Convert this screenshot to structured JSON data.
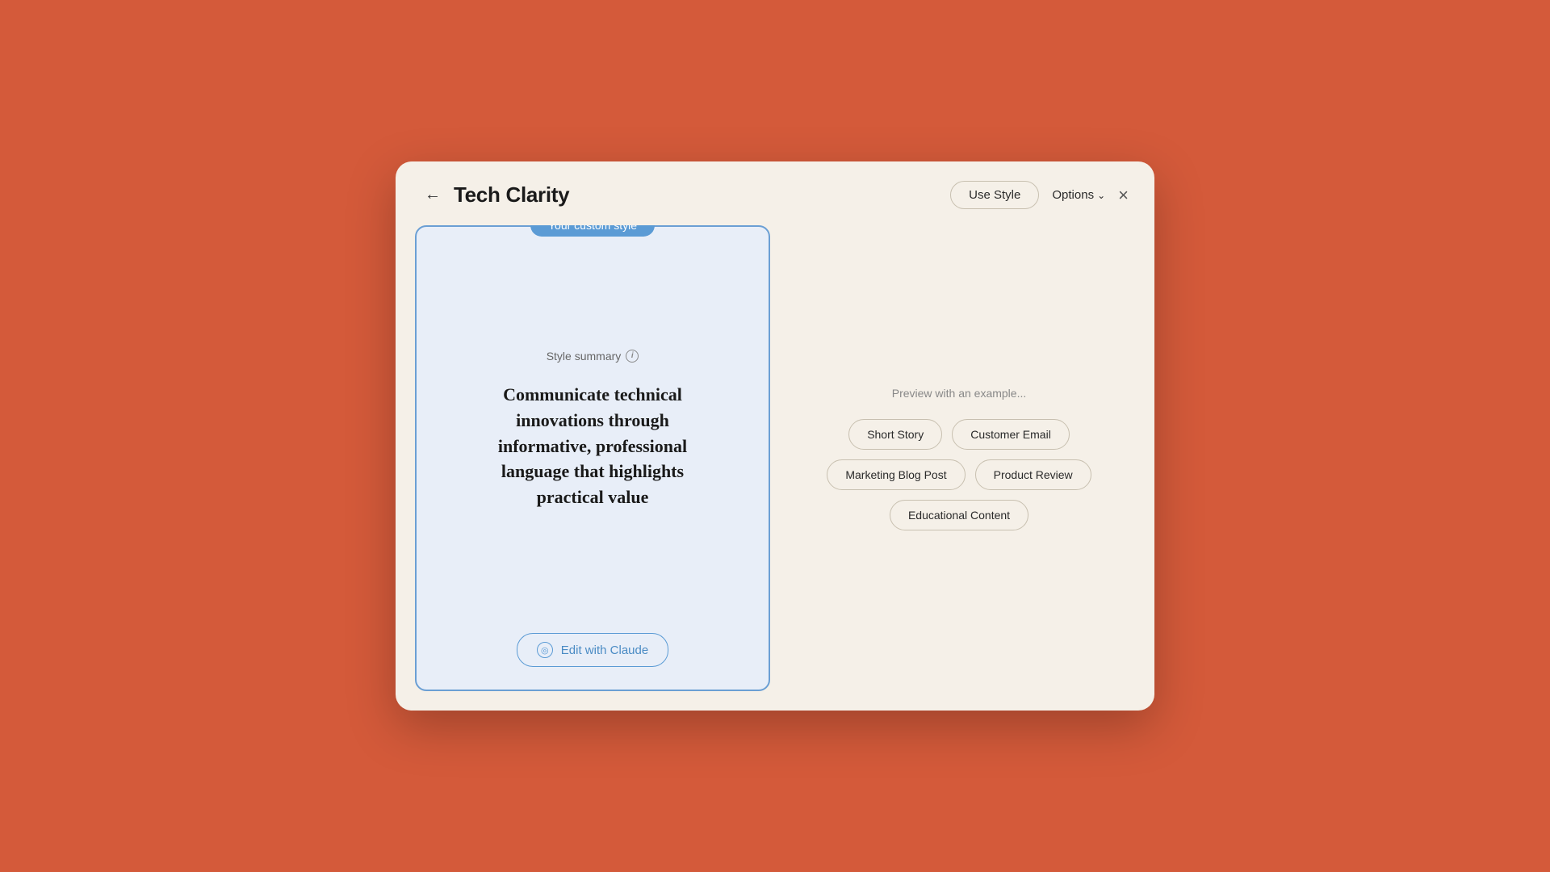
{
  "modal": {
    "title": "Tech Clarity",
    "header": {
      "back_label": "←",
      "use_style_label": "Use Style",
      "options_label": "Options",
      "close_label": "×"
    },
    "left_panel": {
      "badge_label": "Your custom style",
      "style_summary_label": "Style summary",
      "info_icon_label": "i",
      "style_description": "Communicate technical innovations through informative, professional language that highlights practical value",
      "edit_button_label": "Edit with Claude",
      "claude_icon_label": "◎"
    },
    "right_panel": {
      "preview_label": "Preview with an example...",
      "examples": [
        {
          "label": "Short Story",
          "row": 1
        },
        {
          "label": "Customer Email",
          "row": 1
        },
        {
          "label": "Marketing Blog Post",
          "row": 2
        },
        {
          "label": "Product Review",
          "row": 2
        },
        {
          "label": "Educational Content",
          "row": 3
        }
      ]
    }
  }
}
